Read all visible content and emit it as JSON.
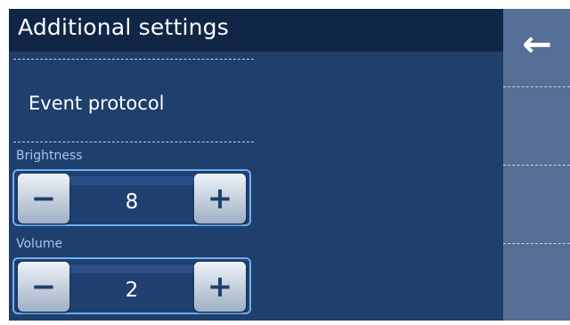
{
  "header": {
    "title": "Additional settings"
  },
  "menu": {
    "event_protocol_label": "Event protocol"
  },
  "brightness": {
    "label": "Brightness",
    "value": "8",
    "minus_icon": "minus-icon",
    "plus_icon": "plus-icon"
  },
  "volume": {
    "label": "Volume",
    "value": "2",
    "minus_icon": "minus-icon",
    "plus_icon": "plus-icon"
  },
  "right_panel": {
    "back_icon": "arrow-left-icon"
  },
  "glyphs": {
    "minus": "−",
    "plus": "+",
    "back": "←"
  },
  "colors": {
    "background": "#1f3f6c",
    "titlebar": "#0f2646",
    "accent": "#6eaef0",
    "label": "#9fc7ee"
  }
}
